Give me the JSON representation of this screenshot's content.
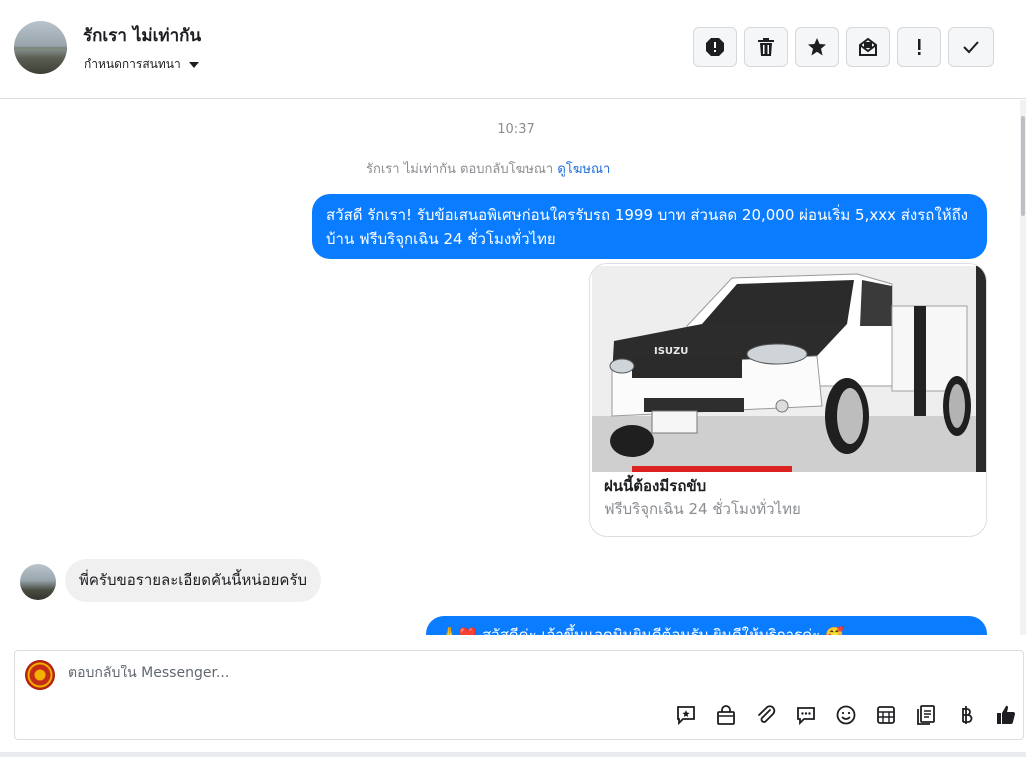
{
  "header": {
    "contact_name": "รักเรา ไม่เท่ากัน",
    "assign_label": "กำหนดการสนทนา",
    "actions": [
      "spam-icon",
      "trash-icon",
      "star-icon",
      "mark-unread-icon",
      "important-icon",
      "done-icon"
    ]
  },
  "thread": {
    "timestamp": "10:37",
    "ad_note_prefix": "รักเรา ไม่เท่ากัน ตอบกลับโฆษณา",
    "ad_note_link": "ดูโฆษณา",
    "outgoing_message": "สวัสดี รักเรา! รับข้อเสนอพิเศษก่อนใครรับรถ 1999 บาท ส่วนลด 20,000  ผ่อนเริ่ม 5,xxx ส่งรถให้ถึงบ้าน ฟรีบริจุกเฉิน 24 ชั่วโมงทั่วไทย",
    "ad_card": {
      "title": "ฝนนี้ต้องมีรถขับ",
      "subtitle": "ฟรีบริจุกเฉิน 24 ชั่วโมงทั่วไทย",
      "brand_text": "ISUZU"
    },
    "incoming_message": "พี่ครับขอรายละเอียดคันนี้หน่อยครับ",
    "outgoing_message_2": "🙏❤️ สวัสดีค่ะ เจ้าขึ้นแอดมินยินดีต้อนรับ ยินดีให้บริการค่ะ 🥰"
  },
  "composer": {
    "placeholder": "ตอบกลับใน Messenger...",
    "tools": [
      "quick-reply-icon",
      "shop-bag-icon",
      "attachment-icon",
      "saved-replies-icon",
      "emoji-icon",
      "table-icon",
      "document-icon",
      "baht-icon",
      "like-icon"
    ]
  },
  "colors": {
    "accent": "#0a7cff",
    "link": "#216fdb",
    "muted": "#8a8d91"
  }
}
